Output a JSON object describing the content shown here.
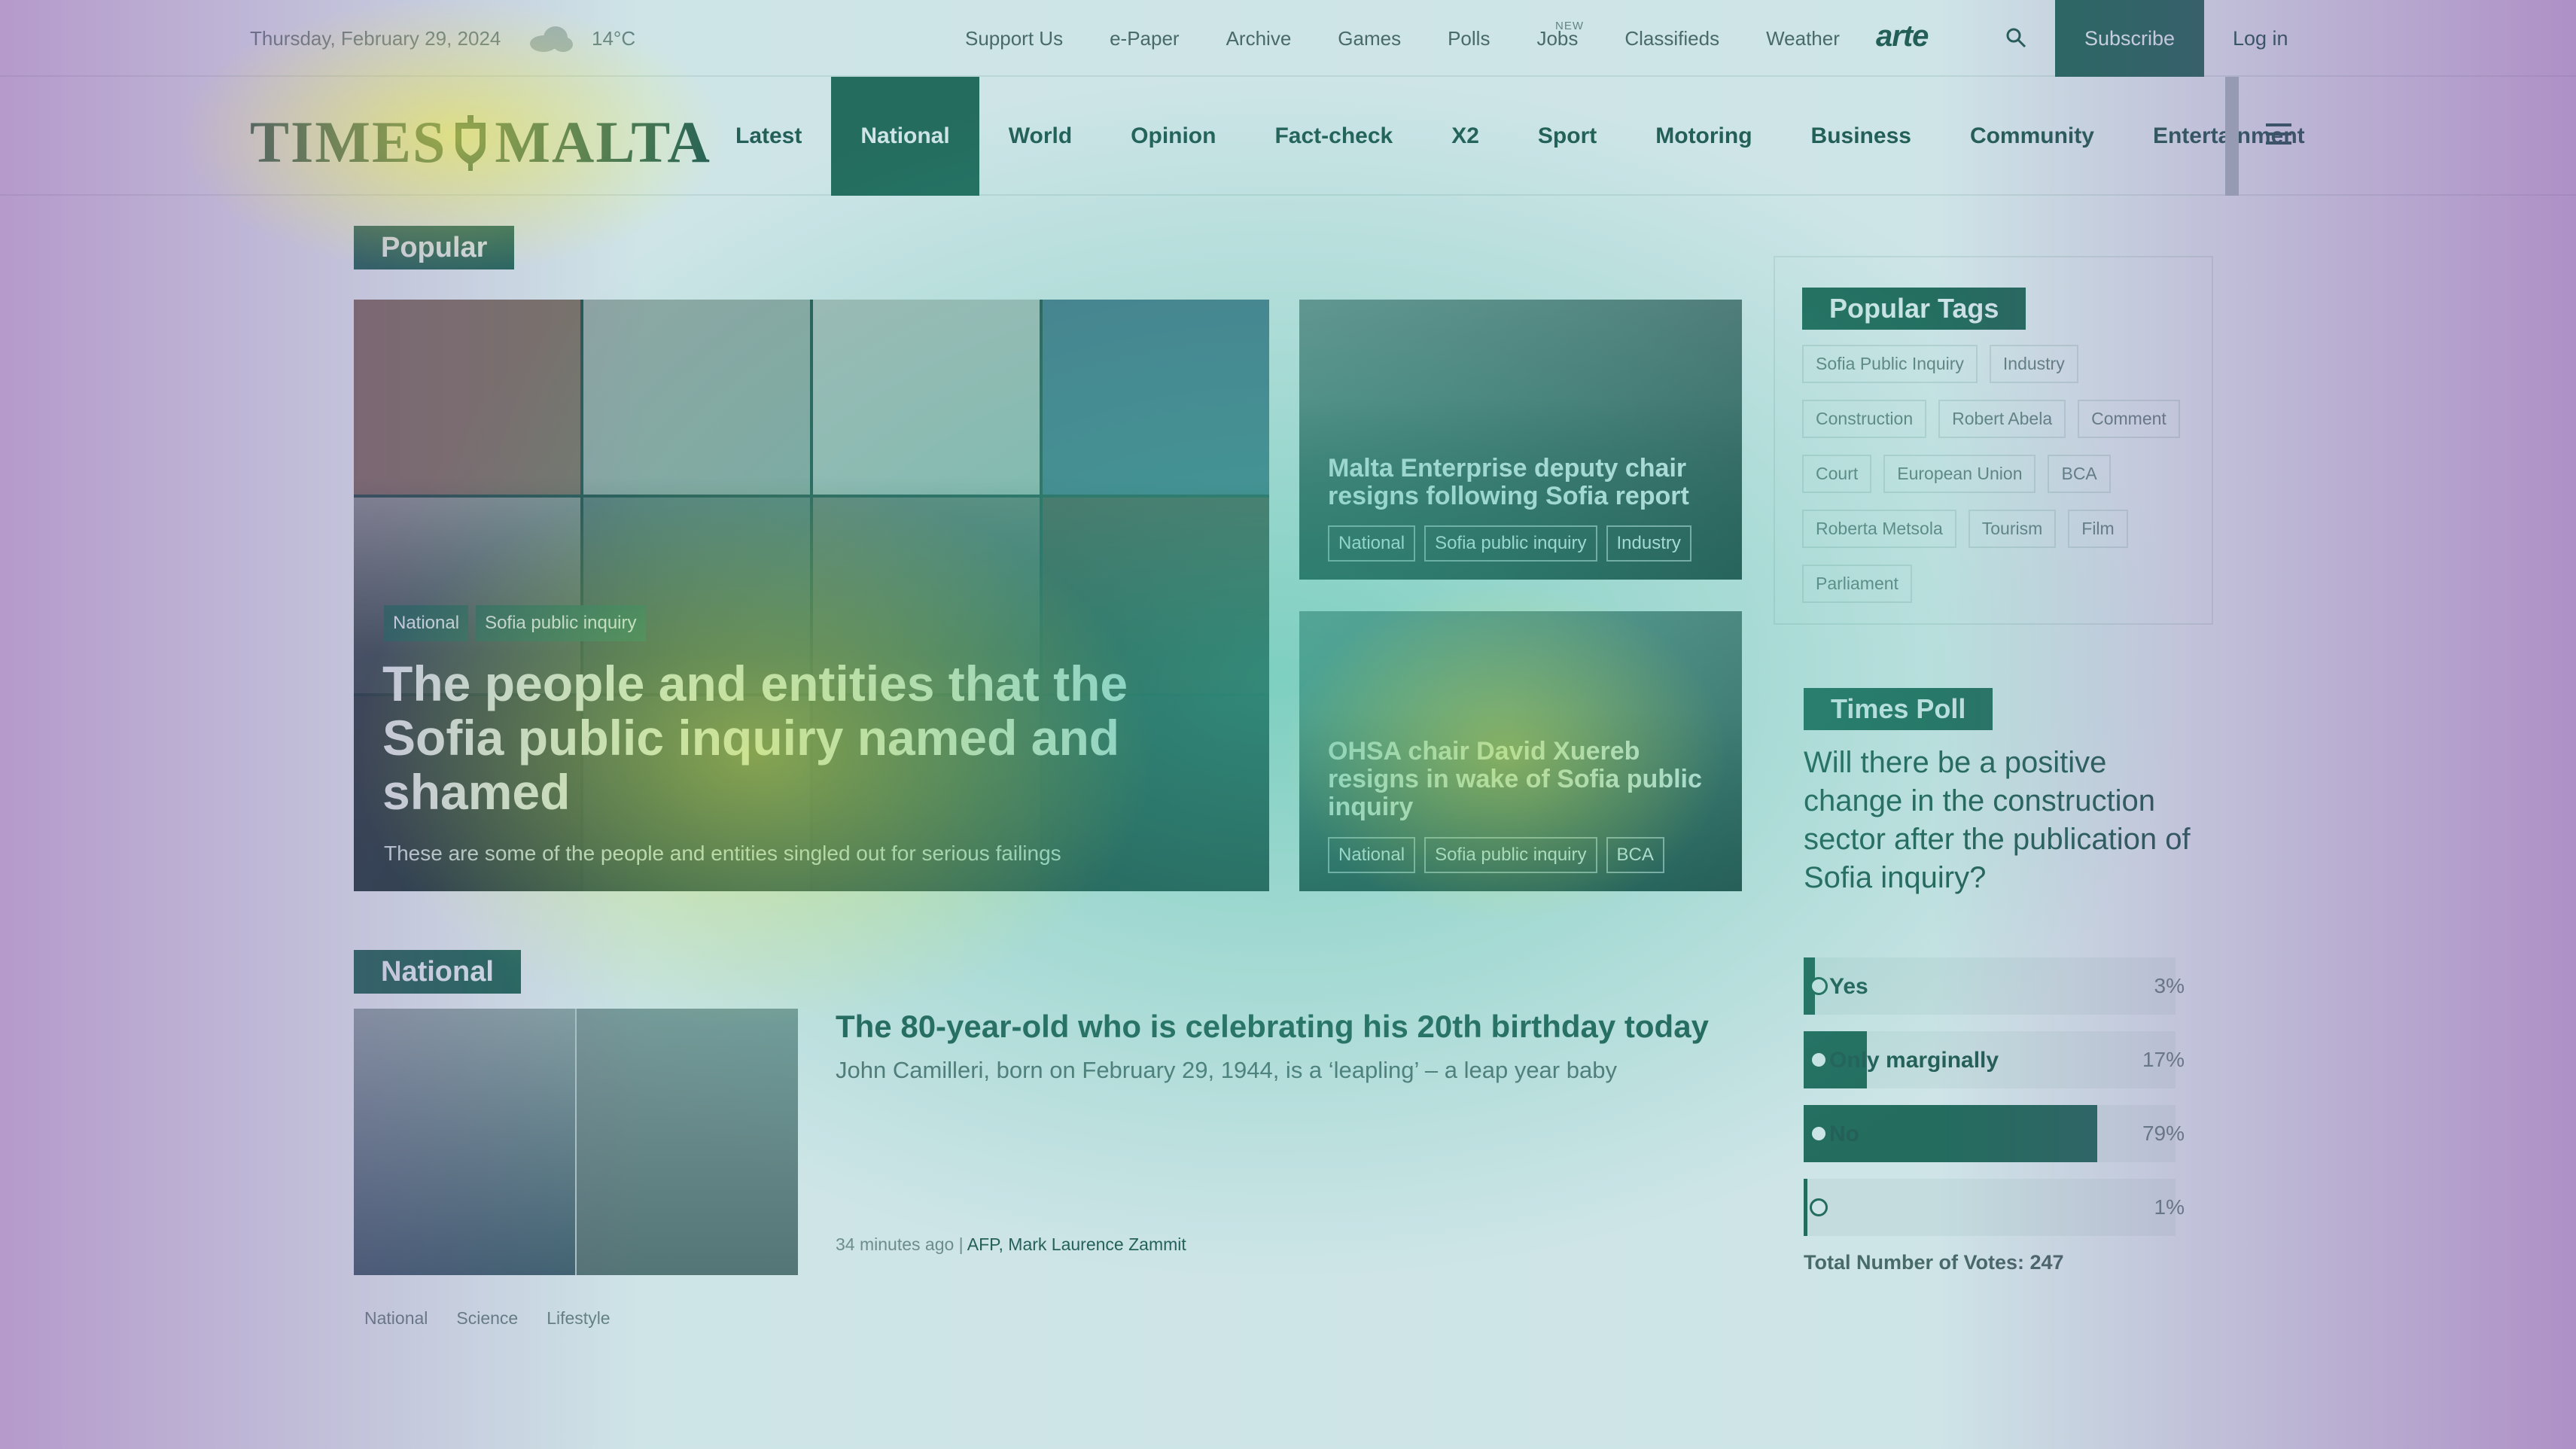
{
  "topbar": {
    "date": "Thursday, February 29, 2024",
    "weather_icon": "cloud-icon",
    "temperature": "14°C",
    "links": [
      "Support Us",
      "e-Paper",
      "Archive",
      "Games",
      "Polls",
      "Jobs",
      "Classifieds",
      "Weather"
    ],
    "jobs_badge": "NEW",
    "partner_logo": "arte",
    "subscribe_label": "Subscribe",
    "login_label": "Log in"
  },
  "nav": {
    "logo_left": "TIMES",
    "logo_right": "MALTA",
    "items": [
      "Latest",
      "National",
      "World",
      "Opinion",
      "Fact-check",
      "X2",
      "Sport",
      "Motoring",
      "Business",
      "Community",
      "Entertainment"
    ],
    "active": "National"
  },
  "popular": {
    "heading": "Popular",
    "hero": {
      "tags": [
        "National",
        "Sofia public inquiry"
      ],
      "title": "The people and entities that the Sofia public inquiry named and shamed",
      "subtitle": "These are some of the people and entities singled out for serious failings"
    },
    "side_stories": [
      {
        "title": "Malta Enterprise deputy chair resigns following Sofia report",
        "tags": [
          "National",
          "Sofia public inquiry",
          "Industry"
        ]
      },
      {
        "title": "OHSA chair David Xuereb resigns in wake of Sofia public inquiry",
        "tags": [
          "National",
          "Sofia public inquiry",
          "BCA"
        ]
      }
    ]
  },
  "popular_tags": {
    "heading": "Popular Tags",
    "tags": [
      "Sofia Public Inquiry",
      "Industry",
      "Construction",
      "Robert Abela",
      "Comment",
      "Court",
      "European Union",
      "BCA",
      "Roberta Metsola",
      "Tourism",
      "Film",
      "Parliament"
    ]
  },
  "poll": {
    "heading": "Times Poll",
    "question": "Will there be a positive change in the construction sector after the publication of Sofia inquiry?",
    "options": [
      {
        "label": "Yes",
        "percent_text": "3%",
        "percent": 3
      },
      {
        "label": "Only marginally",
        "percent_text": "17%",
        "percent": 17
      },
      {
        "label": "No",
        "percent_text": "79%",
        "percent": 79
      },
      {
        "label": "",
        "percent_text": "1%",
        "percent": 1
      }
    ],
    "total": "Total Number of Votes: 247"
  },
  "national": {
    "heading": "National",
    "story": {
      "title": "The 80-year-old who is celebrating his 20th birthday today",
      "subtitle": "John Camilleri, born on February 29, 1944, is a ‘leapling’ – a leap year baby",
      "time": "34 minutes ago |",
      "author": "AFP, Mark Laurence Zammit",
      "tags": [
        "National",
        "Science",
        "Lifestyle"
      ]
    }
  },
  "colors": {
    "brand_green": "#1b5e48",
    "text_green": "#1b4d3e"
  }
}
